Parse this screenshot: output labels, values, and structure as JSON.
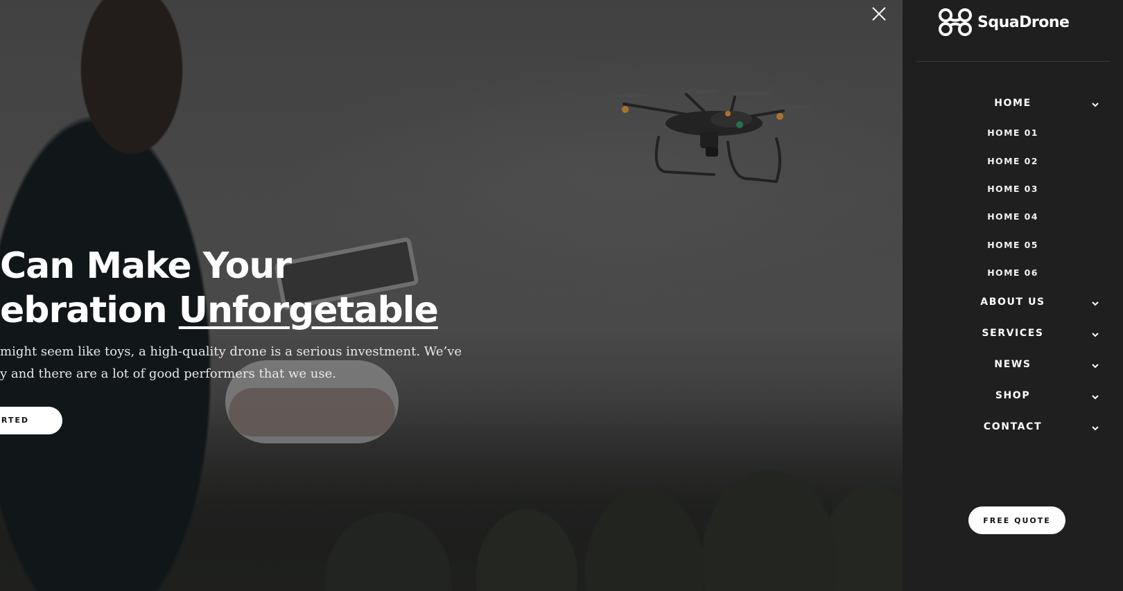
{
  "hero": {
    "title_line1": "Can Make Your",
    "title_line2_plain": "ebration ",
    "title_line2_underlined": "Unforgetable",
    "body_line1": "might seem like toys, a high-quality drone is a serious investment. We’ve",
    "body_line2": "y and there are a lot of good performers that we use.",
    "cta_label": "ARTED",
    "close_icon": "close-icon"
  },
  "sidebar": {
    "logo_text": "SquaDrone",
    "menu": [
      {
        "label": "HOME",
        "has_children": true
      },
      {
        "label": "ABOUT US",
        "has_children": true
      },
      {
        "label": "SERVICES",
        "has_children": true
      },
      {
        "label": "NEWS",
        "has_children": true
      },
      {
        "label": "SHOP",
        "has_children": true
      },
      {
        "label": "CONTACT",
        "has_children": true
      }
    ],
    "home_submenu": [
      "HOME 01",
      "HOME 02",
      "HOME 03",
      "HOME 04",
      "HOME 05",
      "HOME 06"
    ],
    "quote_button": "FREE QUOTE"
  },
  "colors": {
    "sidebar_bg": "#1f1f1f",
    "accent": "#ffffff"
  }
}
